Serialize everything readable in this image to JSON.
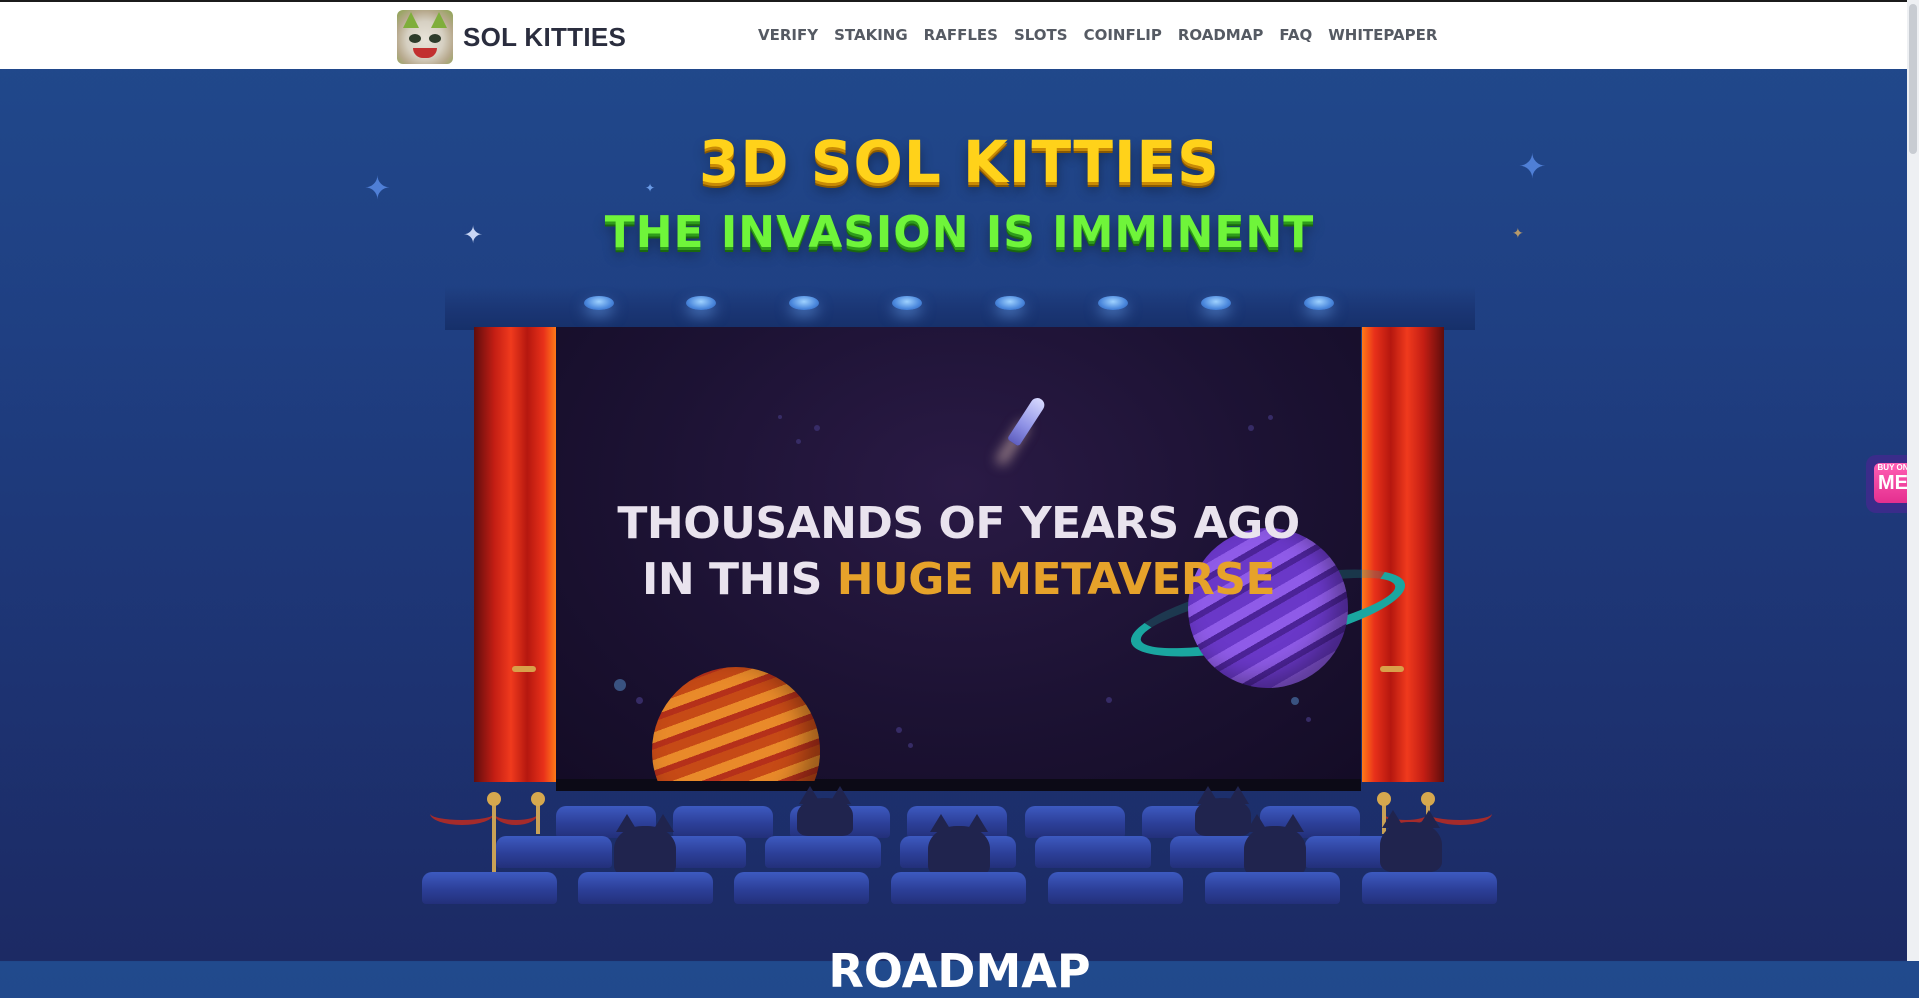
{
  "header": {
    "logo_text": "SOL KITTIES",
    "nav": [
      "VERIFY",
      "STAKING",
      "RAFFLES",
      "SLOTS",
      "COINFLIP",
      "ROADMAP",
      "FAQ",
      "WHITEPAPER"
    ]
  },
  "hero": {
    "title": "3D SOL KITTIES",
    "subtitle": "THE INVASION IS IMMINENT",
    "screen_line1": "THOUSANDS OF YEARS AGO",
    "screen_line2_prefix": "IN THIS ",
    "screen_line2_highlight": "HUGE METAVERSE"
  },
  "next_section_title": "ROADMAP",
  "buy_badge": {
    "small": "BUY ON",
    "big": "ME"
  },
  "colors": {
    "title": "#ffd21a",
    "subtitle": "#6ff53a",
    "highlight": "#e6a22a",
    "background": "#1f3f82"
  },
  "icons": [
    "logo-kitty-icon",
    "sparkle-star-icon",
    "magic-eden-badge-icon"
  ]
}
